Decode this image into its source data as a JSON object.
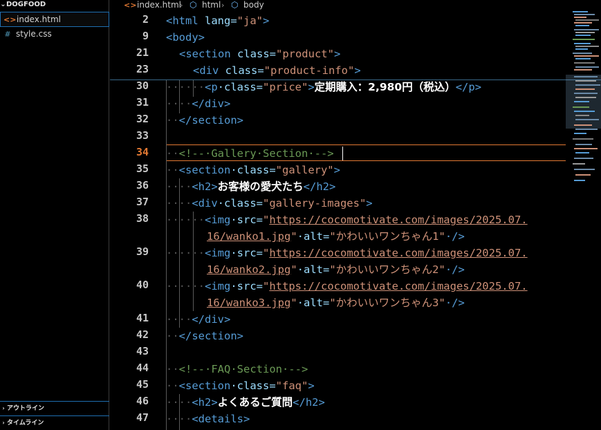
{
  "sidebar": {
    "project_title": "DOGFOOD",
    "files": [
      {
        "name": "index.html",
        "icon": "html-file-icon",
        "glyph": "<>",
        "active": true
      },
      {
        "name": "style.css",
        "icon": "css-file-icon",
        "glyph": "#",
        "active": false
      }
    ],
    "panels": [
      "アウトライン",
      "タイムライン"
    ]
  },
  "breadcrumb": {
    "file": "index.html",
    "html": "html",
    "body": "body"
  },
  "lines": [
    {
      "num": "2"
    },
    {
      "num": "9"
    },
    {
      "num": "21"
    },
    {
      "num": "23"
    },
    {
      "num": "30"
    },
    {
      "num": "31"
    },
    {
      "num": "32"
    },
    {
      "num": "33"
    },
    {
      "num": "34"
    },
    {
      "num": "35"
    },
    {
      "num": "36"
    },
    {
      "num": "37"
    },
    {
      "num": "38"
    },
    {
      "num": "39"
    },
    {
      "num": "40"
    },
    {
      "num": "41"
    },
    {
      "num": "42"
    },
    {
      "num": "43"
    },
    {
      "num": "44"
    },
    {
      "num": "45"
    },
    {
      "num": "46"
    },
    {
      "num": "47"
    }
  ],
  "code": {
    "l2": {
      "open": "<html",
      "attr": " lang=",
      "val": "\"ja\"",
      "close": ">"
    },
    "l9": {
      "tag": "<body>"
    },
    "l21": {
      "open": "<section",
      "attr": " class=",
      "val": "\"product\"",
      "close": ">"
    },
    "l23": {
      "open": "<div",
      "attr": " class=",
      "val": "\"product-info\"",
      "close": ">"
    },
    "l30": {
      "open": "<p",
      "attr": "·class=",
      "val": "\"price\"",
      "close": ">",
      "text": "定期購入：2,980円（税込）",
      "end": "</p>"
    },
    "l31": {
      "tag": "</div>"
    },
    "l32": {
      "tag": "</section>"
    },
    "l34": {
      "comment": "<!--·Gallery·Section·-->"
    },
    "l35": {
      "open": "<section",
      "attr": "·class=",
      "val": "\"gallery\"",
      "close": ">"
    },
    "l36": {
      "open": "<h2>",
      "text": "お客様の愛犬たち",
      "end": "</h2>"
    },
    "l37": {
      "open": "<div",
      "attr": "·class=",
      "val": "\"gallery-images\"",
      "close": ">"
    },
    "img_open": "<img",
    "img_src_attr": "·src=",
    "img_alt_attr": "·alt=",
    "img_close": "·/>",
    "l38": {
      "url1": "https://cocomotivate.com/images/2025.07.",
      "url2": "16/wanko1.jpg",
      "alt": "\"かわいいワンちゃん1\""
    },
    "l39": {
      "url1": "https://cocomotivate.com/images/2025.07.",
      "url2": "16/wanko2.jpg",
      "alt": "\"かわいいワンちゃん2\""
    },
    "l40": {
      "url1": "https://cocomotivate.com/images/2025.07.",
      "url2": "16/wanko3.jpg",
      "alt": "\"かわいいワンちゃん3\""
    },
    "l41": {
      "tag": "</div>"
    },
    "l42": {
      "tag": "</section>"
    },
    "l44": {
      "comment": "<!--·FAQ·Section·-->"
    },
    "l45": {
      "open": "<section",
      "attr": "·class=",
      "val": "\"faq\"",
      "close": ">"
    },
    "l46": {
      "open": "<h2>",
      "text": "よくあるご質問",
      "end": "</h2>"
    },
    "l47": {
      "tag": "<details>"
    }
  },
  "colors": {
    "tag": "#569cd6",
    "attribute": "#9cdcfe",
    "string": "#ce9178",
    "comment": "#6a9955",
    "current_line_number": "#e37933",
    "accent": "#1f6fb2"
  }
}
